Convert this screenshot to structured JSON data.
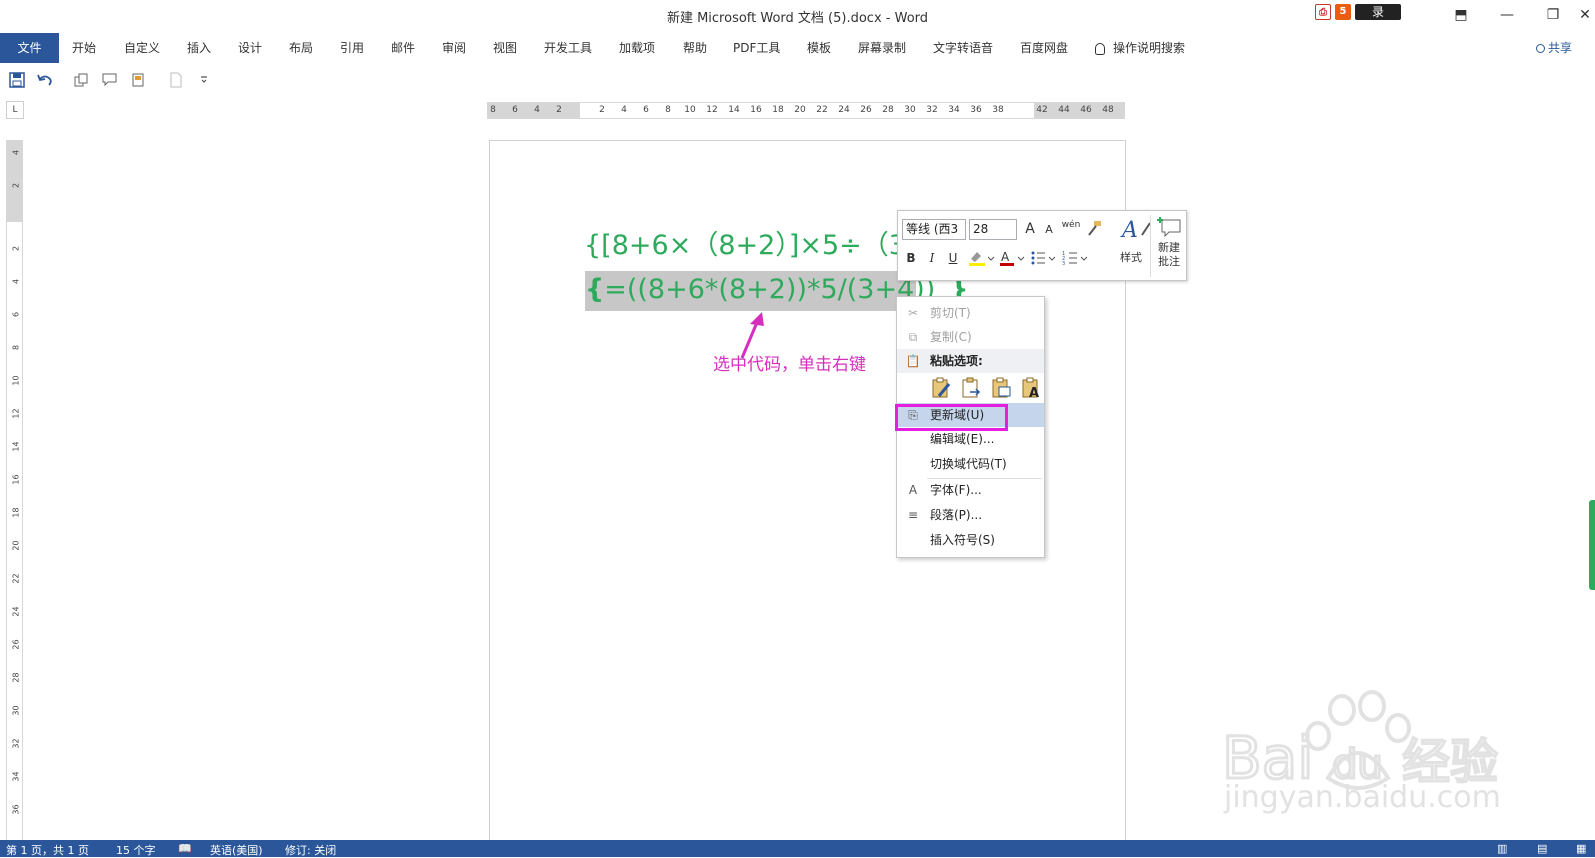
{
  "window": {
    "title": "新建 Microsoft Word 文档 (5).docx  -  Word",
    "login_label": "录",
    "buttons": {
      "ribbon_options": "⬒",
      "minimize": "—",
      "restore": "❐",
      "close": "✕"
    }
  },
  "ribbon": {
    "tabs": [
      {
        "label": "文件"
      },
      {
        "label": "开始"
      },
      {
        "label": "自定义"
      },
      {
        "label": "插入"
      },
      {
        "label": "设计"
      },
      {
        "label": "布局"
      },
      {
        "label": "引用"
      },
      {
        "label": "邮件"
      },
      {
        "label": "审阅"
      },
      {
        "label": "视图"
      },
      {
        "label": "开发工具"
      },
      {
        "label": "加载项"
      },
      {
        "label": "帮助"
      },
      {
        "label": "PDF工具"
      },
      {
        "label": "模板"
      },
      {
        "label": "屏幕录制"
      },
      {
        "label": "文字转语音"
      },
      {
        "label": "百度网盘"
      }
    ],
    "tell_me": "操作说明搜索",
    "share": "共享"
  },
  "ruler": {
    "corner": "L",
    "h_numbers": [
      "8",
      "6",
      "4",
      "2",
      "2",
      "4",
      "6",
      "8",
      "10",
      "12",
      "14",
      "16",
      "18",
      "20",
      "22",
      "24",
      "26",
      "28",
      "30",
      "32",
      "34",
      "36",
      "38",
      "42",
      "44",
      "46",
      "48"
    ],
    "v_numbers": [
      "4",
      "2",
      "2",
      "4",
      "6",
      "8",
      "10",
      "12",
      "14",
      "16",
      "18",
      "20",
      "22",
      "24",
      "26",
      "28",
      "30",
      "32",
      "34",
      "36"
    ]
  },
  "document": {
    "line1": "{[8+6×（8+2）]×5÷（3",
    "field_brace": "{",
    "field_code": "=((8+6*(8+2))*5/(3+4))",
    "field_close": "}",
    "annotation": "选中代码，单击右键"
  },
  "mini_toolbar": {
    "font_name": "等线 (西3",
    "font_size": "28",
    "grow_font": "A",
    "shrink_font": "A",
    "phonetic": "wén",
    "bold": "B",
    "italic": "I",
    "underline": "U",
    "styles_label": "样式",
    "new_comment_label1": "新建",
    "new_comment_label2": "批注"
  },
  "context_menu": {
    "cut": "剪切(T)",
    "copy": "复制(C)",
    "paste_header": "粘贴选项:",
    "update_field": "更新域(U)",
    "edit_field": "编辑域(E)...",
    "toggle_codes": "切换域代码(T)",
    "font": "字体(F)...",
    "paragraph": "段落(P)...",
    "insert_symbol": "插入符号(S)"
  },
  "status": {
    "page": "第 1 页，共 1 页",
    "words": "15 个字",
    "language": "英语(美国)",
    "track": "修订: 关闭"
  },
  "watermark": {
    "sub": "jingyan.baidu.com",
    "main": "Bai du 经验"
  },
  "colors": {
    "accent": "#2b579a",
    "formula": "#2eaa5c",
    "annotation": "#d62fbd",
    "highlight_box": "#e61ee0"
  }
}
